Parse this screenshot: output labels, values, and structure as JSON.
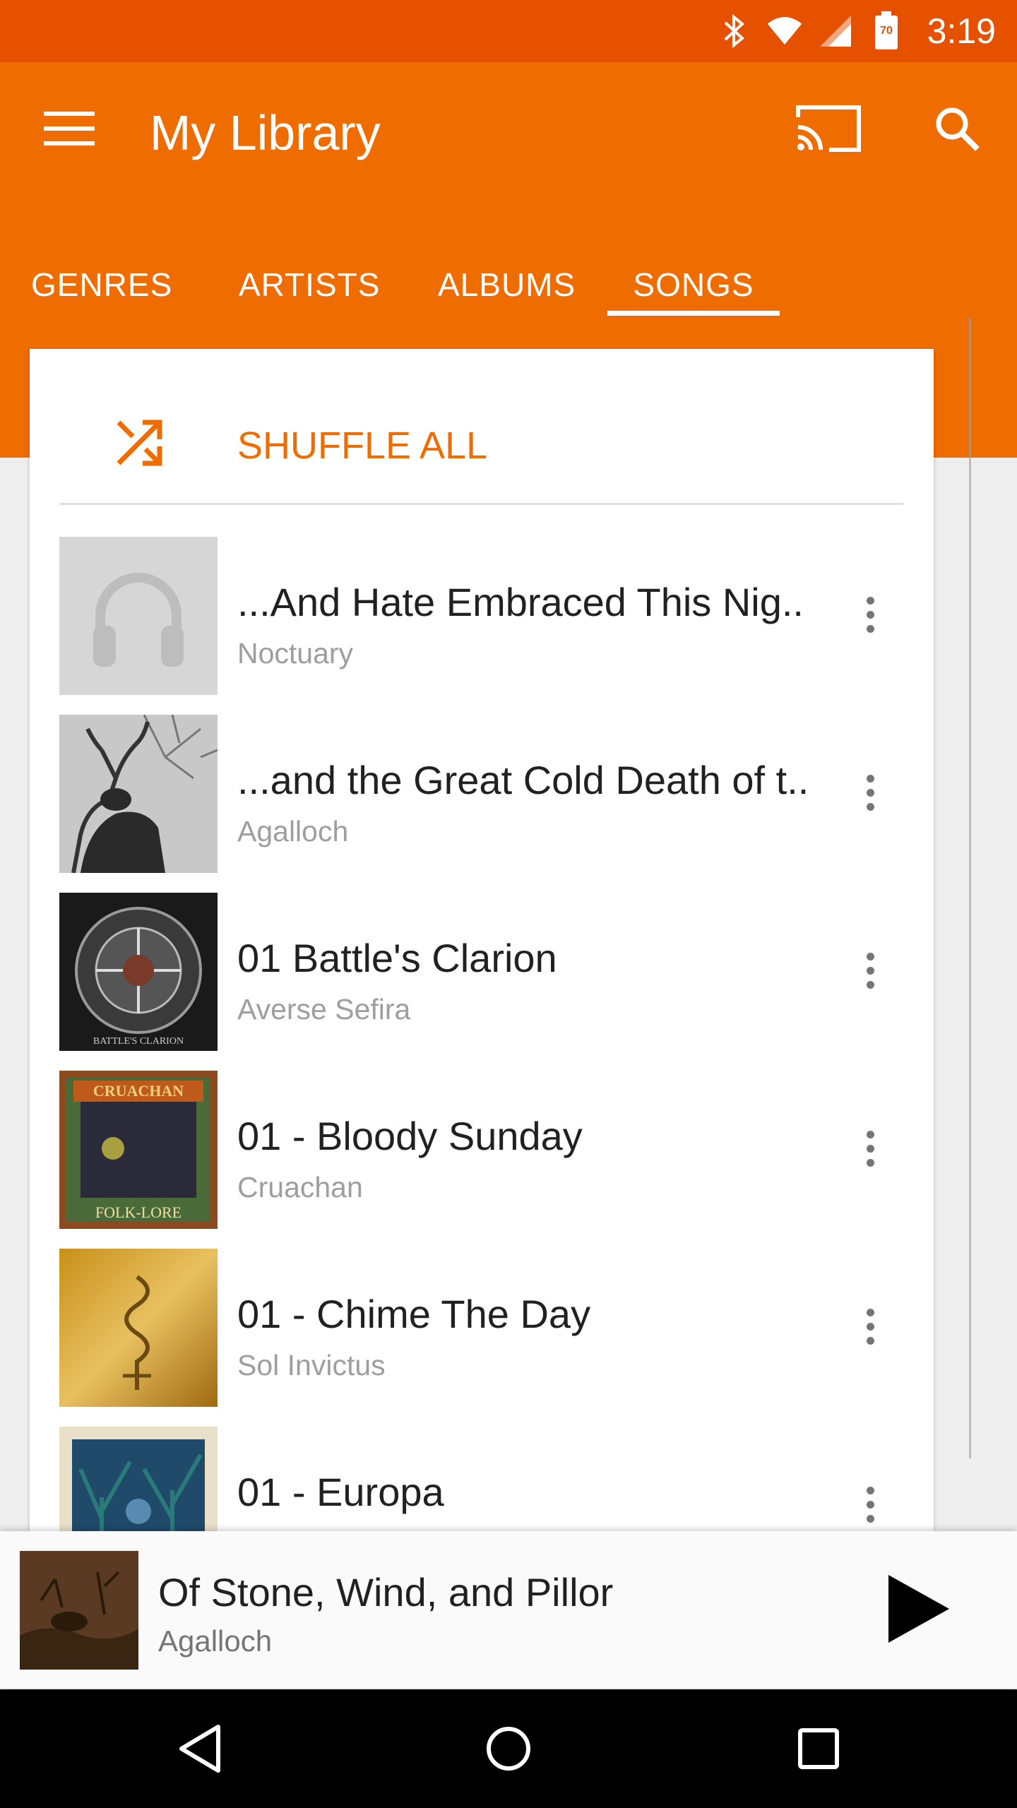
{
  "status_bar": {
    "time": "3:19",
    "battery_level": "70",
    "icons": [
      "bluetooth-icon",
      "wifi-icon",
      "cell-signal-icon",
      "battery-icon"
    ],
    "color": "#e65100"
  },
  "app_bar": {
    "title": "My Library",
    "color": "#ef6c00",
    "actions": [
      "cast-icon",
      "search-icon"
    ]
  },
  "tabs": {
    "items": [
      {
        "label": "GENRES"
      },
      {
        "label": "ARTISTS"
      },
      {
        "label": "ALBUMS"
      },
      {
        "label": "SONGS"
      }
    ],
    "selected": "SONGS"
  },
  "shuffle": {
    "label": "SHUFFLE ALL",
    "accent_color": "#ef6c00"
  },
  "songs": [
    {
      "title": "...And Hate Embraced This Nig..",
      "artist": "Noctuary",
      "cover": "default-headphones-art"
    },
    {
      "title": "...and the Great Cold Death of t..",
      "artist": "Agalloch",
      "cover": "stag-art"
    },
    {
      "title": "01 Battle's Clarion",
      "artist": "Averse Sefira",
      "cover": "circular-emblem-art"
    },
    {
      "title": "01 - Bloody Sunday",
      "artist": "Cruachan",
      "cover": "celtic-border-art"
    },
    {
      "title": "01 - Chime The Day",
      "artist": "Sol Invictus",
      "cover": "gold-serpent-art"
    },
    {
      "title": "01 - Europa",
      "artist": "",
      "cover": "blue-tree-art"
    }
  ],
  "cover_text": {
    "battles_clarion": "BATTLE'S CLARION",
    "cruachan_logo": "CRUACHAN",
    "folk_lore": "FOLK-LORE"
  },
  "mini_player": {
    "title": "Of Stone, Wind, and Pillor",
    "artist": "Agalloch"
  },
  "nav_bar": {
    "buttons": [
      "back-icon",
      "home-icon",
      "recents-icon"
    ]
  }
}
